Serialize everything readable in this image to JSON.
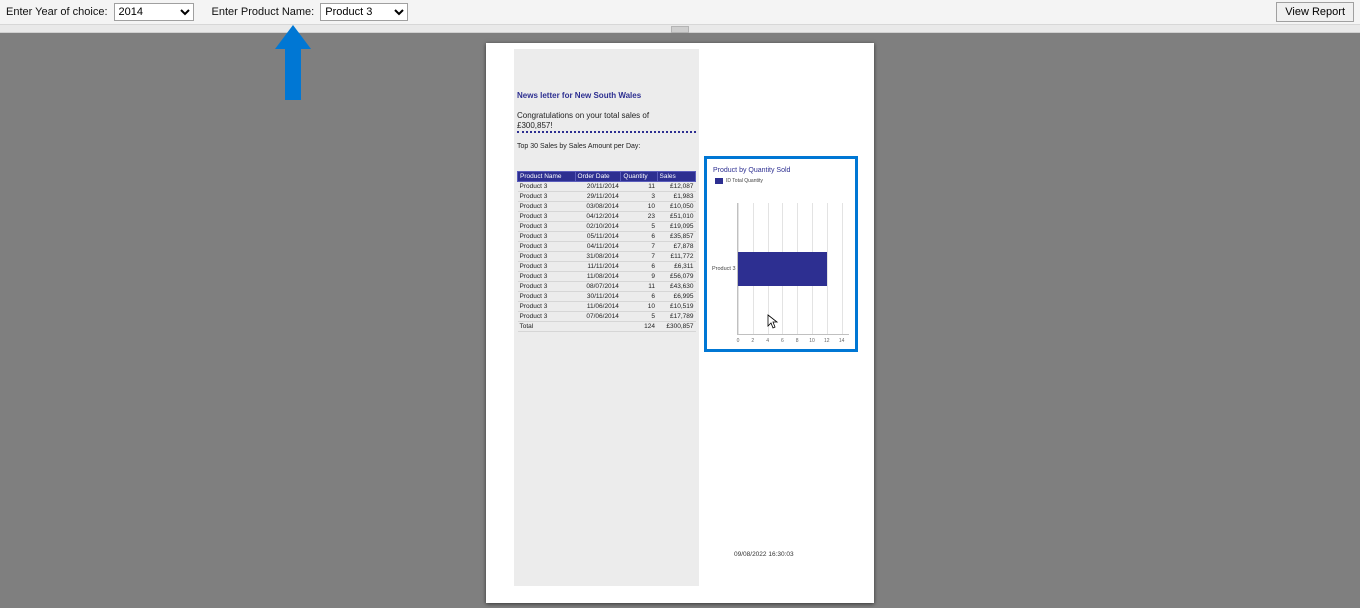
{
  "toolbar": {
    "year_label": "Enter Year of choice:",
    "year_value": "2014",
    "product_label": "Enter Product Name:",
    "product_value": "Product 3",
    "view_report": "View Report"
  },
  "report": {
    "title": "News letter for New South Wales",
    "congrats_line1": "Congratulations on your total sales of",
    "congrats_line2": "£300,857!",
    "top30": "Top 30 Sales by Sales Amount per Day:",
    "columns": {
      "product": "Product Name",
      "date": "Order Date",
      "qty": "Quantity",
      "sales": "Sales"
    },
    "rows": [
      {
        "p": "Product 3",
        "d": "20/11/2014",
        "q": "11",
        "s": "£12,087"
      },
      {
        "p": "Product 3",
        "d": "29/11/2014",
        "q": "3",
        "s": "£1,983"
      },
      {
        "p": "Product 3",
        "d": "03/08/2014",
        "q": "10",
        "s": "£10,050"
      },
      {
        "p": "Product 3",
        "d": "04/12/2014",
        "q": "23",
        "s": "£51,010"
      },
      {
        "p": "Product 3",
        "d": "02/10/2014",
        "q": "5",
        "s": "£19,095"
      },
      {
        "p": "Product 3",
        "d": "05/11/2014",
        "q": "6",
        "s": "£35,857"
      },
      {
        "p": "Product 3",
        "d": "04/11/2014",
        "q": "7",
        "s": "£7,878"
      },
      {
        "p": "Product 3",
        "d": "31/08/2014",
        "q": "7",
        "s": "£11,772"
      },
      {
        "p": "Product 3",
        "d": "11/11/2014",
        "q": "6",
        "s": "£6,311"
      },
      {
        "p": "Product 3",
        "d": "11/08/2014",
        "q": "9",
        "s": "£56,079"
      },
      {
        "p": "Product 3",
        "d": "08/07/2014",
        "q": "11",
        "s": "£43,630"
      },
      {
        "p": "Product 3",
        "d": "30/11/2014",
        "q": "6",
        "s": "£6,995"
      },
      {
        "p": "Product 3",
        "d": "11/06/2014",
        "q": "10",
        "s": "£10,519"
      },
      {
        "p": "Product 3",
        "d": "07/06/2014",
        "q": "5",
        "s": "£17,789"
      }
    ],
    "total_label": "Total",
    "total_qty": "124",
    "total_sales": "£300,857",
    "footer_ts": "09/08/2022 16:30:03"
  },
  "chart": {
    "title": "Product by Quantity Sold",
    "legend": "ID Total Quantity",
    "ylabel": "Product 3",
    "xticks": [
      "0",
      "2",
      "4",
      "6",
      "8",
      "10",
      "12",
      "14"
    ]
  },
  "chart_data": {
    "type": "bar",
    "orientation": "horizontal",
    "categories": [
      "Product 3"
    ],
    "values": [
      12
    ],
    "title": "Product by Quantity Sold",
    "xlabel": "",
    "ylabel": "",
    "xlim": [
      0,
      15
    ],
    "legend": [
      "ID Total Quantity"
    ]
  }
}
